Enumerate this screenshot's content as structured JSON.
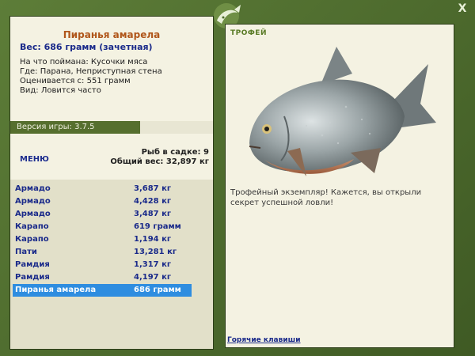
{
  "window": {
    "close_label": "X"
  },
  "fish_info": {
    "name": "Пиранья амарела",
    "weight_line": "Вес: 686 грамм (зачетная)",
    "caught_on": "На что поймана: Кусочки мяса",
    "location": "Где: Парана, Неприступная стена",
    "rated_from": "Оценивается с: 551 грамм",
    "kind": "Вид: Ловится часто"
  },
  "version_label": "Версия игры: 3.7.5",
  "menu_label": "МЕНЮ",
  "cage": {
    "count_line": "Рыб в садке: 9",
    "total_line": "Общий вес: 32,897 кг"
  },
  "fish_list": [
    {
      "name": "Армадо",
      "weight": "3,687 кг"
    },
    {
      "name": "Армадо",
      "weight": "4,428 кг"
    },
    {
      "name": "Армадо",
      "weight": "3,487 кг"
    },
    {
      "name": "Карапо",
      "weight": "619 грамм"
    },
    {
      "name": "Карапо",
      "weight": "1,194 кг"
    },
    {
      "name": "Пати",
      "weight": "13,281 кг"
    },
    {
      "name": "Рамдия",
      "weight": "1,317 кг"
    },
    {
      "name": "Рамдия",
      "weight": "4,197 кг"
    },
    {
      "name": "Пиранья амарела",
      "weight": "686 грамм",
      "selected": true
    }
  ],
  "trophy": {
    "label": "ТРОФЕЙ",
    "text": "Трофейный экземпляр! Кажется, вы открыли секрет успешной ловли!"
  },
  "hotkeys_label": "Горячие клавиши",
  "colors": {
    "frame_green": "#4e6b2f",
    "panel_beige": "#f4f2e2",
    "link_blue": "#1a2a8a",
    "selection_blue": "#2e8de0",
    "fish_name_orange": "#b0561a"
  }
}
